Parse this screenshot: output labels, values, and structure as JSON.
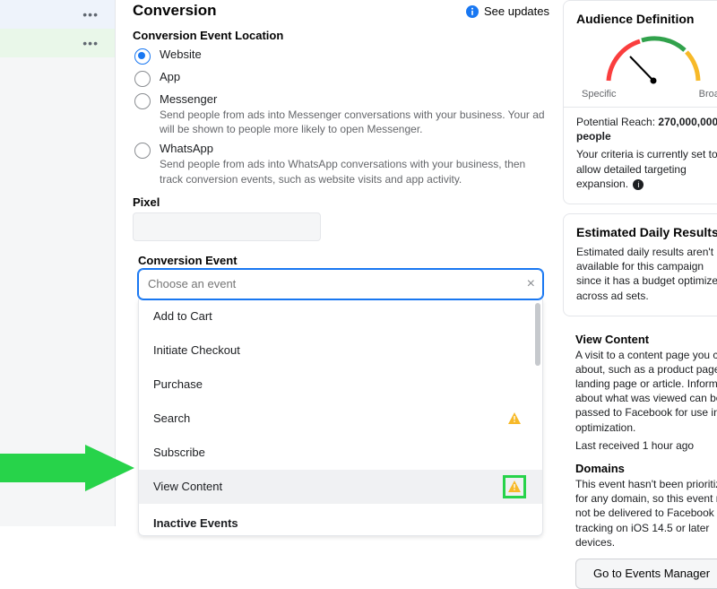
{
  "header": {
    "title": "Conversion",
    "see_updates": "See updates",
    "event_location_label": "Conversion Event Location",
    "pixel_label": "Pixel",
    "event_label": "Conversion Event",
    "event_placeholder": "Choose an event",
    "inactive_label": "Inactive Events"
  },
  "radio_options": [
    {
      "label": "Website",
      "help": "",
      "selected": true
    },
    {
      "label": "App",
      "help": "",
      "selected": false
    },
    {
      "label": "Messenger",
      "help": "Send people from ads into Messenger conversations with your business. Your ad will be shown to people more likely to open Messenger.",
      "selected": false
    },
    {
      "label": "WhatsApp",
      "help": "Send people from ads into WhatsApp conversations with your business, then track conversion events, such as website visits and app activity.",
      "selected": false
    }
  ],
  "events": [
    {
      "label": "Add to Cart",
      "warning": false
    },
    {
      "label": "Initiate Checkout",
      "warning": false
    },
    {
      "label": "Purchase",
      "warning": false
    },
    {
      "label": "Search",
      "warning": true
    },
    {
      "label": "Subscribe",
      "warning": false
    },
    {
      "label": "View Content",
      "warning": true,
      "highlighted": true
    }
  ],
  "audience": {
    "title": "Audience Definition",
    "specific": "Specific",
    "broad": "Broad",
    "reach_label": "Potential Reach:",
    "reach_value": "270,000,000 people",
    "criteria_text": "Your criteria is currently set to allow detailed targeting expansion."
  },
  "est": {
    "title": "Estimated Daily Results",
    "text": "Estimated daily results aren't available for this campaign since it has a budget optimized across ad sets."
  },
  "tooltip": {
    "title": "View Content",
    "desc": "A visit to a content page you care about, such as a product page, landing page or article. Information about what was viewed can be passed to Facebook for use in optimization.",
    "last": "Last received 1 hour ago",
    "domains_title": "Domains",
    "domains_text": "This event hasn't been prioritized for any domain, so this event may not be delivered to Facebook for tracking on iOS 14.5 or later devices.",
    "button": "Go to Events Manager"
  }
}
